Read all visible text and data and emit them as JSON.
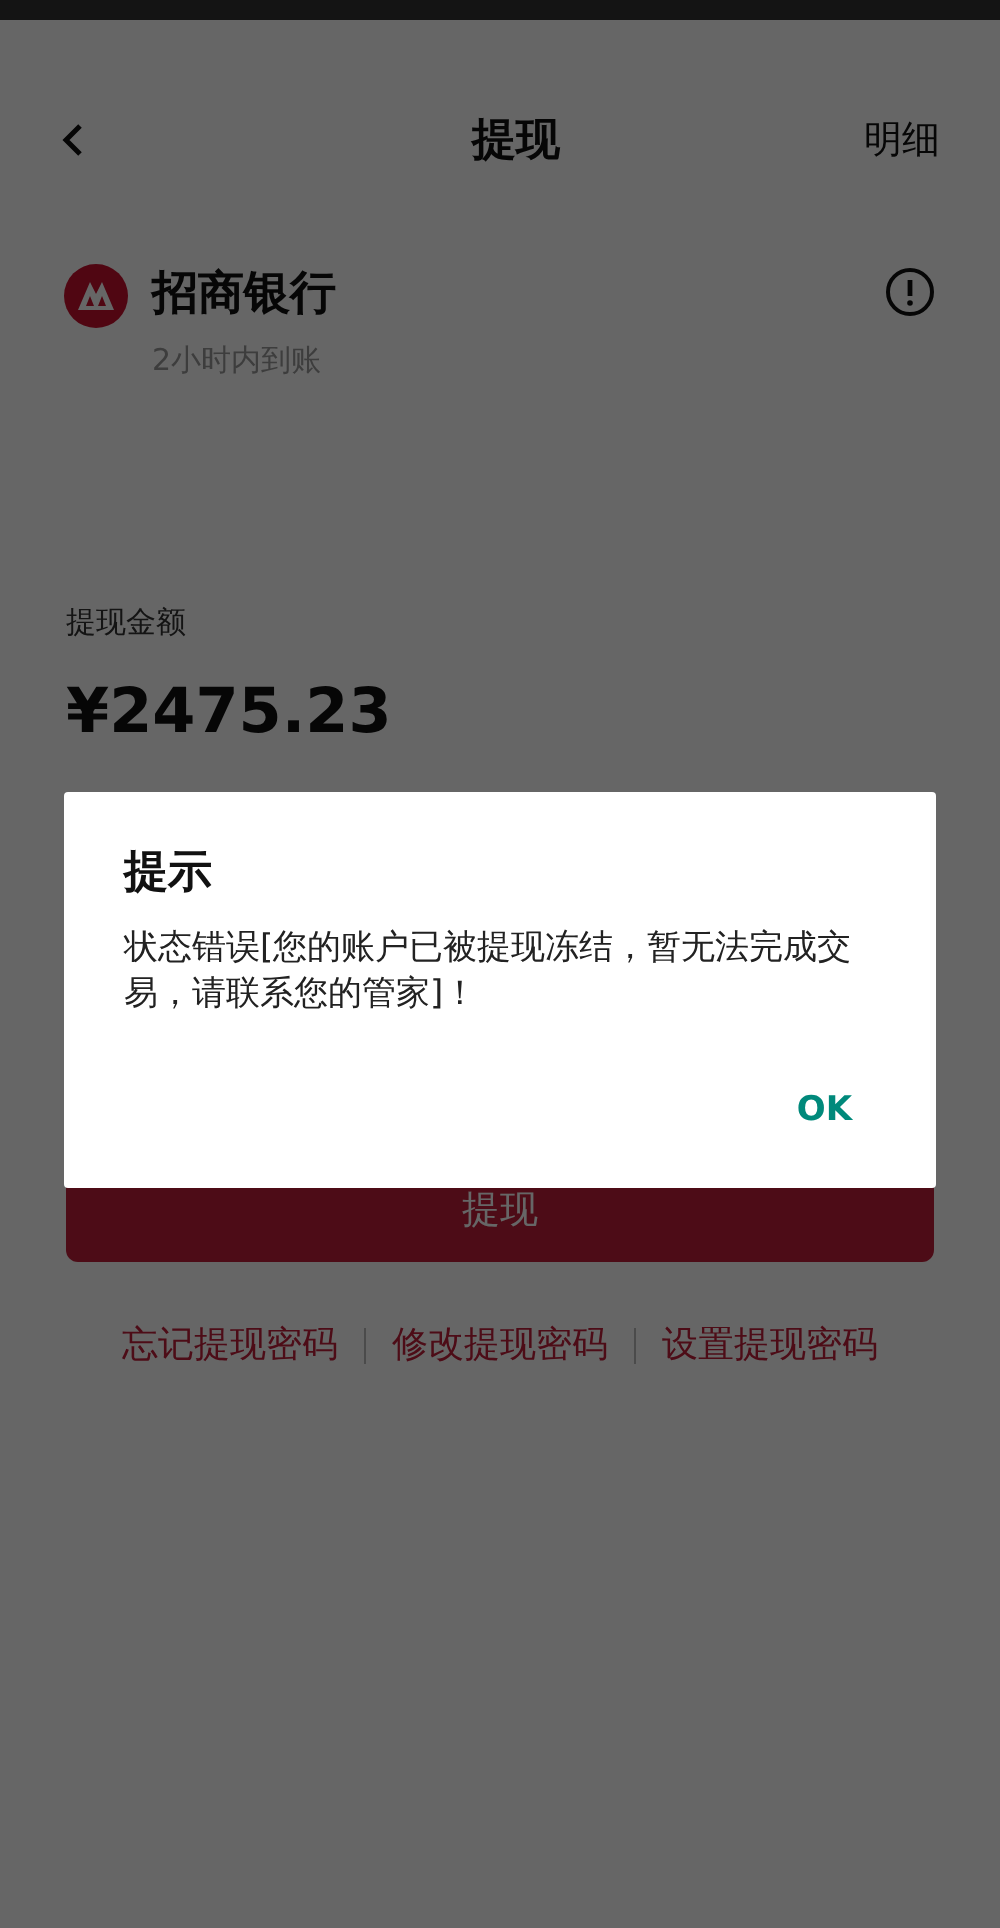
{
  "header": {
    "title": "提现",
    "action": "明细"
  },
  "bank": {
    "name": "招商银行",
    "note": "2小时内到账"
  },
  "amount": {
    "label": "提现金额",
    "value": "¥2475.23"
  },
  "submit_button": "提现",
  "links": [
    "忘记提现密码",
    "修改提现密码",
    "设置提现密码"
  ],
  "dialog": {
    "title": "提示",
    "message": "状态错误[您的账户已被提现冻结，暂无法完成交易，请联系您的管家]！",
    "button": "OK"
  }
}
